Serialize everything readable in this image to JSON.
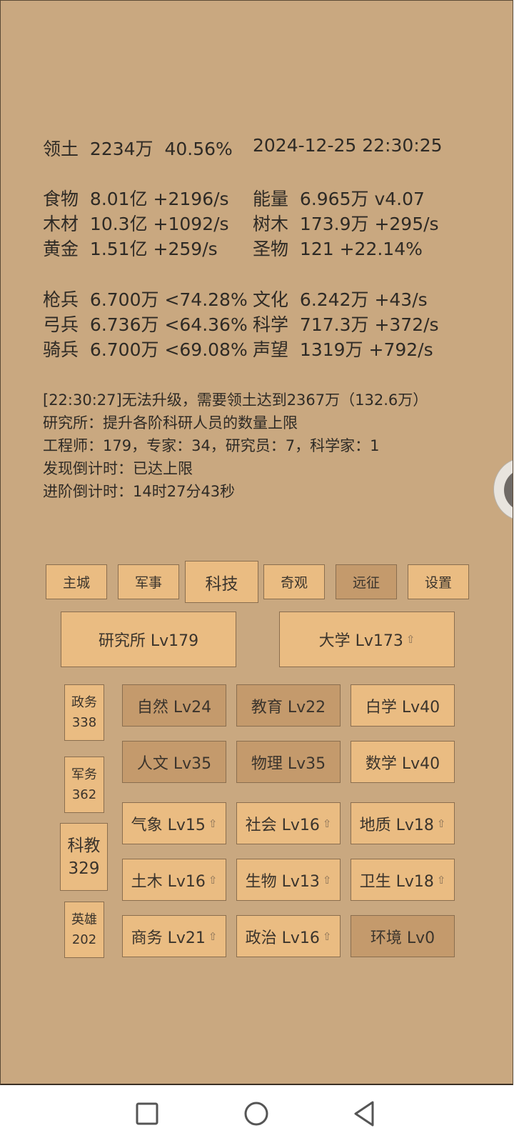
{
  "stats": {
    "r1": [
      [
        "领土",
        "2234万",
        "40.56%"
      ]
    ],
    "datetime": "2024-12-25 22:30:25",
    "left": [
      {
        "name": "食物",
        "value": "8.01亿 +2196/s"
      },
      {
        "name": "木材",
        "value": "10.3亿 +1092/s"
      },
      {
        "name": "黄金",
        "value": "1.51亿 +259/s"
      },
      {
        "name": "枪兵",
        "value": "6.700万 <74.28%"
      },
      {
        "name": "弓兵",
        "value": "6.736万 <64.36%"
      },
      {
        "name": "骑兵",
        "value": "6.700万 <69.08%"
      }
    ],
    "right": [
      {
        "name": "能量",
        "value": "6.965万  v4.07"
      },
      {
        "name": "树木",
        "value": "173.9万 +295/s"
      },
      {
        "name": "圣物",
        "value": "121 +22.14%"
      },
      {
        "name": "文化",
        "value": "6.242万 +43/s"
      },
      {
        "name": "科学",
        "value": "717.3万 +372/s"
      },
      {
        "name": "声望",
        "value": "1319万 +792/s"
      }
    ]
  },
  "log": [
    "[22:30:27]无法升级，需要领土达到2367万（132.6万）",
    "研究所：提升各阶科研人员的数量上限",
    "工程师：179，专家：34，研究员：7，科学家：1",
    "发现倒计时：已达上限",
    "进阶倒计时：14时27分43秒"
  ],
  "tabs": [
    "主城",
    "军事",
    "科技",
    "奇观",
    "远征",
    "设置"
  ],
  "buildings": {
    "institute": "研究所 Lv179",
    "university": "大学 Lv173",
    "upgrade_arrow": "⇧"
  },
  "side": [
    {
      "name": "政务",
      "value": "338"
    },
    {
      "name": "军务",
      "value": "362"
    },
    {
      "name": "科教",
      "value": "329"
    },
    {
      "name": "英雄",
      "value": "202"
    }
  ],
  "grid": [
    [
      "自然 Lv24",
      "教育 Lv22",
      "白学 Lv40"
    ],
    [
      "人文 Lv35",
      "物理 Lv35",
      "数学 Lv40"
    ],
    [
      "气象 Lv15",
      "社会 Lv16",
      "地质 Lv18"
    ],
    [
      "土木 Lv16",
      "生物 Lv13",
      "卫生 Lv18"
    ],
    [
      "商务 Lv21",
      "政治 Lv16",
      "环境 Lv0"
    ]
  ]
}
